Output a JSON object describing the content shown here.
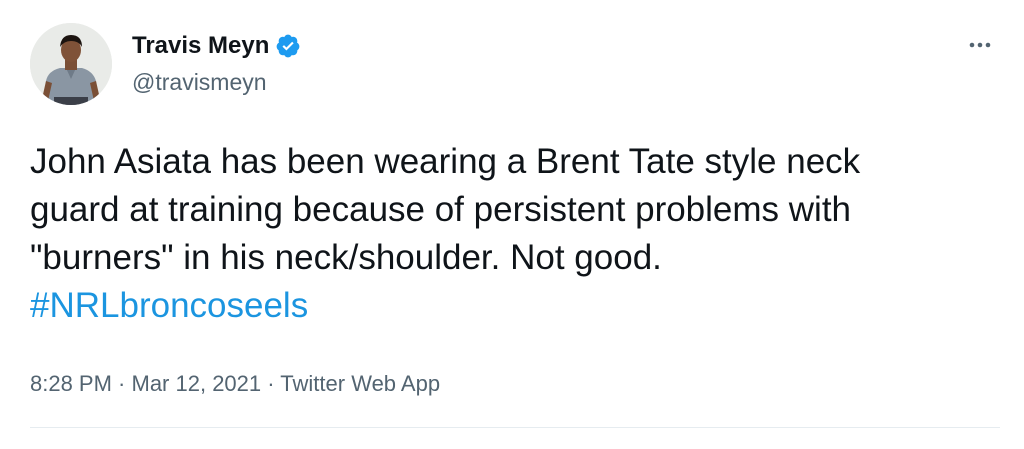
{
  "author": {
    "display_name": "Travis Meyn",
    "handle": "@travismeyn",
    "verified": true,
    "verified_icon": "verified-badge-icon",
    "avatar_icon": "profile-photo"
  },
  "menu": {
    "more_icon": "more-options-icon",
    "more_glyph": "···"
  },
  "tweet": {
    "lines": [
      "John Asiata has been wearing a Brent Tate style neck",
      "guard at training because of persistent problems with",
      "\"burners\" in his neck/shoulder. Not good."
    ],
    "hashtag": "#NRLbroncoseels"
  },
  "meta": {
    "time": "8:28 PM",
    "separator": " · ",
    "date": "Mar 12, 2021",
    "source": "Twitter Web App"
  },
  "colors": {
    "link": "#1b95e0",
    "secondary_text": "#536471",
    "verified": "#1d9bf0"
  }
}
